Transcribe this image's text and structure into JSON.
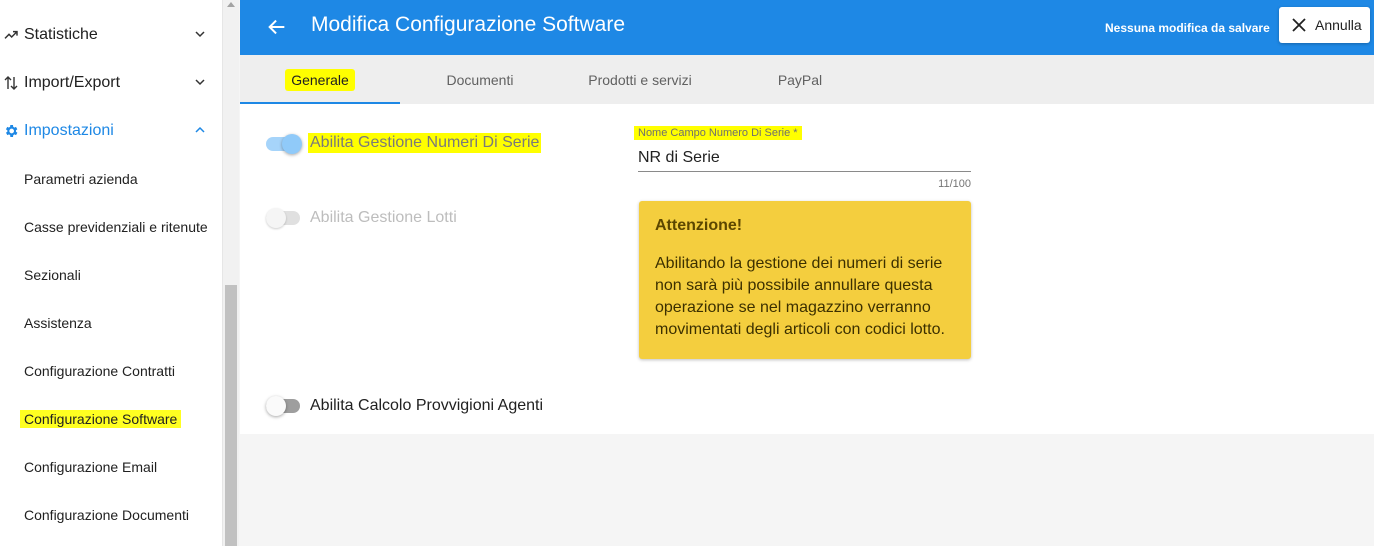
{
  "sidebar": {
    "groups": [
      {
        "label": "Statistiche",
        "icon": "trending-up-icon"
      },
      {
        "label": "Import/Export",
        "icon": "swap-vertical-icon"
      },
      {
        "label": "Impostazioni",
        "icon": "gear-icon"
      }
    ],
    "items": [
      {
        "label": "Parametri azienda"
      },
      {
        "label": "Casse previdenziali e ritenute"
      },
      {
        "label": "Sezionali"
      },
      {
        "label": "Assistenza"
      },
      {
        "label": "Configurazione Contratti"
      },
      {
        "label": "Configurazione Software"
      },
      {
        "label": "Configurazione Email"
      },
      {
        "label": "Configurazione Documenti"
      }
    ]
  },
  "header": {
    "title": "Modifica Configurazione Software",
    "save_status": "Nessuna modifica da salvare",
    "cancel_label": "Annulla"
  },
  "tabs": [
    {
      "label": "Generale"
    },
    {
      "label": "Documenti"
    },
    {
      "label": "Prodotti e servizi"
    },
    {
      "label": "PayPal"
    }
  ],
  "settings": {
    "serial_numbers": {
      "label": "Abilita Gestione Numeri Di Serie",
      "enabled": true
    },
    "lots": {
      "label": "Abilita Gestione Lotti",
      "enabled": false
    },
    "agent_commissions": {
      "label": "Abilita Calcolo Provvigioni Agenti",
      "enabled": false
    }
  },
  "serial_field": {
    "label": "Nome Campo Numero Di Serie *",
    "value": "NR di Serie",
    "counter": "11/100"
  },
  "warning": {
    "title": "Attenzione!",
    "text": "Abilitando la gestione dei numeri di serie non sarà più possibile annullare questa operazione se nel magazzino verranno movimentati degli articoli con codici lotto."
  },
  "colors": {
    "primary": "#1e88e5",
    "highlight": "#ffff00",
    "warning_bg": "#f4ce3e"
  }
}
